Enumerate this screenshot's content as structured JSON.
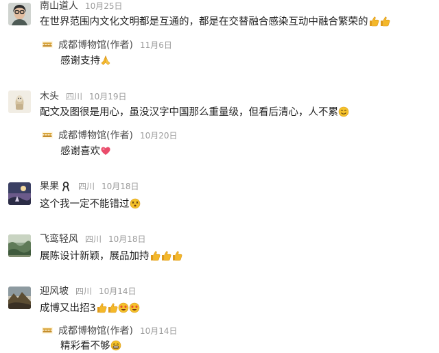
{
  "comments": [
    {
      "name": "南山道人",
      "location": "",
      "date": "10月25日",
      "text": "在世界范围内文化文明都是互通的，都是在交替融合感染互动中融合繁荣的",
      "text_emojis": [
        "thumbs-up-icon",
        "thumbs-up-icon"
      ],
      "reply": {
        "author": "成都博物馆(作者)",
        "date": "11月6日",
        "text": "感谢支持",
        "text_emojis": [
          "praying-hands-icon"
        ]
      }
    },
    {
      "name": "木头",
      "location": "四川",
      "date": "10月19日",
      "text": "配文及图很是用心，虽没汉字中国那么重量级，但看后清心，人不累",
      "text_emojis": [
        "smile-face-icon"
      ],
      "reply": {
        "author": "成都博物馆(作者)",
        "date": "10月20日",
        "text": "感谢喜欢",
        "text_emojis": [
          "heart-icon"
        ]
      }
    },
    {
      "name": "果果",
      "name_emoji": "ribbon-icon",
      "location": "四川",
      "date": "10月18日",
      "text": "这个我一定不能错过",
      "text_emojis": [
        "dizzy-face-icon"
      ]
    },
    {
      "name": "飞鸾轻风",
      "location": "四川",
      "date": "10月18日",
      "text": "展陈设计新颖，展品加持",
      "text_emojis": [
        "thumbs-up-icon",
        "thumbs-up-icon",
        "thumbs-up-icon"
      ]
    },
    {
      "name": "迎风坡",
      "location": "四川",
      "date": "10月14日",
      "text": "成博又出招3",
      "text_emojis": [
        "thumbs-up-icon",
        "thumbs-up-icon",
        "starstruck-face-icon",
        "starstruck-face-icon"
      ],
      "reply": {
        "author": "成都博物馆(作者)",
        "date": "10月14日",
        "text": "精彩看不够",
        "text_emojis": [
          "grin-face-icon"
        ]
      }
    }
  ],
  "colors": {
    "emoji_yellow": "#f4b829",
    "heart": "#ea4c6b",
    "meta_gray": "#9a9a9a"
  }
}
